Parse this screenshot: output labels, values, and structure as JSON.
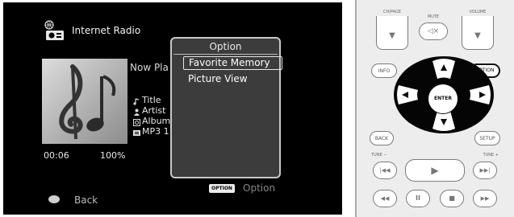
{
  "screen": {
    "title": "Internet Radio",
    "now_playing": "Now Pla",
    "meta": [
      {
        "icon": "note-icon",
        "text": "Title"
      },
      {
        "icon": "person-icon",
        "text": "Artist"
      },
      {
        "icon": "album-icon",
        "text": "Album"
      },
      {
        "icon": "format-icon",
        "text": "MP3 1"
      }
    ],
    "time": "00:06",
    "volume": "100%",
    "back_label": "Back",
    "option_popup": {
      "title": "Option",
      "items": [
        "Favorite Memory",
        "Picture View"
      ],
      "selected_index": 0
    },
    "option_key_label": "OPTION",
    "option_hint": "Option"
  },
  "remote": {
    "ch_page_label": "CH/PAGE",
    "mute_label": "MUTE",
    "volume_label": "VOLUME",
    "info_label": "INFO",
    "option_label": "OPTION",
    "enter_label": "ENTER",
    "back_label": "BACK",
    "setup_label": "SETUP",
    "tune_minus_label": "TUNE −",
    "tune_plus_label": "TUNE +",
    "mute_glyph": "◁×",
    "down_glyph": "▼",
    "play_glyph": "▶",
    "prev_glyph": "|◀◀",
    "next_glyph": "▶▶|",
    "rewind_glyph": "◀◀",
    "pause_glyph": "II",
    "stop_glyph": "■",
    "ff_glyph": "▶▶"
  }
}
